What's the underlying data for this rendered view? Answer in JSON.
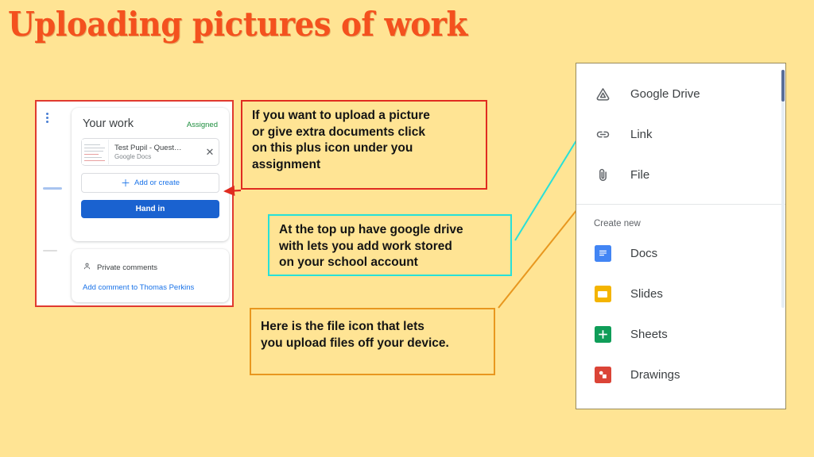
{
  "slide": {
    "title": "Uploading pictures of work",
    "background_color": "#ffe494",
    "title_color": "#f4511e"
  },
  "left_screenshot": {
    "name": "google-classroom-your-work-panel",
    "border_color": "#e02b20",
    "your_work": {
      "heading": "Your work",
      "status": "Assigned",
      "status_color": "#1e8e3e",
      "attachment": {
        "name": "Test Pupil - Quest…",
        "type": "Google Docs",
        "remove_label": "✕"
      },
      "add_or_create": "Add or create",
      "add_icon": "plus-icon",
      "hand_in": "Hand in",
      "hand_in_color": "#1a62d0"
    },
    "private_comments": {
      "heading": "Private comments",
      "person_icon": "person-icon",
      "add_comment_link": "Add comment to Thomas Perkins"
    },
    "kebab_icon": "more-vertical-icon"
  },
  "callouts": [
    {
      "id": "plus-icon-callout",
      "border_color": "#e02b20",
      "text": "If you want to upload a picture\nor give extra documents click\non this plus icon under you\nassignment"
    },
    {
      "id": "google-drive-callout",
      "border_color": "#27e0d8",
      "text": "At the top up have google drive\nwith lets you add work stored\non your school account"
    },
    {
      "id": "file-icon-callout",
      "border_color": "#e8971f",
      "text": "Here is the file icon that lets\nyou upload files off your device."
    }
  ],
  "arrows": [
    {
      "id": "red-arrow-to-add-or-create",
      "color": "#e02b20"
    },
    {
      "id": "cyan-arrow-to-google-drive",
      "color": "#27e0d8"
    },
    {
      "id": "orange-arrow-to-file",
      "color": "#e8971f"
    }
  ],
  "right_screenshot": {
    "name": "attach-menu",
    "attach_items": [
      {
        "label": "Google Drive",
        "icon": "google-drive-icon",
        "icon_color": "#5f6368"
      },
      {
        "label": "Link",
        "icon": "link-icon",
        "icon_color": "#5f6368"
      },
      {
        "label": "File",
        "icon": "paperclip-icon",
        "icon_color": "#5f6368"
      }
    ],
    "create_new_label": "Create new",
    "create_items": [
      {
        "label": "Docs",
        "icon": "google-docs-icon",
        "icon_color": "#4285f4"
      },
      {
        "label": "Slides",
        "icon": "google-slides-icon",
        "icon_color": "#f4b400"
      },
      {
        "label": "Sheets",
        "icon": "google-sheets-icon",
        "icon_color": "#0f9d58"
      },
      {
        "label": "Drawings",
        "icon": "google-drawings-icon",
        "icon_color": "#db4437"
      }
    ],
    "scrollbar_color": "#3f5787"
  }
}
